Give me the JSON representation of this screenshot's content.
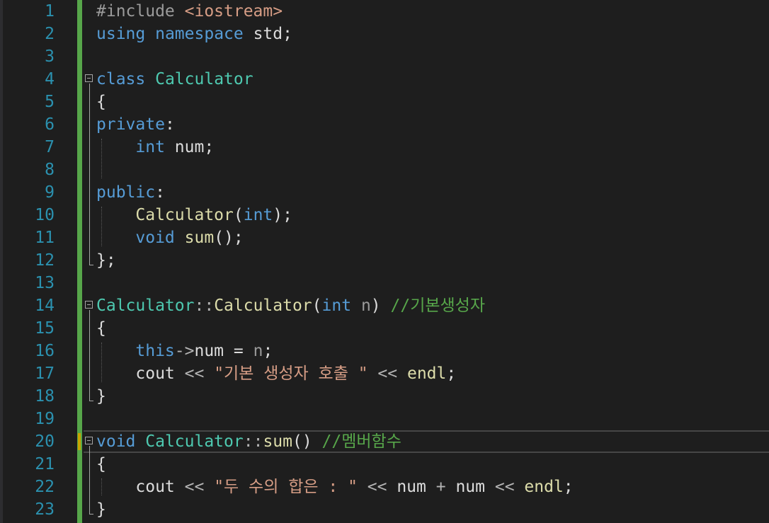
{
  "editor": {
    "lines": [
      {
        "n": "1",
        "tokens": [
          {
            "c": "pp",
            "t": "#include "
          },
          {
            "c": "inc",
            "t": "<iostream>"
          }
        ]
      },
      {
        "n": "2",
        "tokens": [
          {
            "c": "kw",
            "t": "using"
          },
          {
            "c": "txt",
            "t": " "
          },
          {
            "c": "kw",
            "t": "namespace"
          },
          {
            "c": "txt",
            "t": " std;"
          }
        ]
      },
      {
        "n": "3",
        "tokens": []
      },
      {
        "n": "4",
        "fold": true,
        "tokens": [
          {
            "c": "kw",
            "t": "class"
          },
          {
            "c": "txt",
            "t": " "
          },
          {
            "c": "type",
            "t": "Calculator"
          }
        ]
      },
      {
        "n": "5",
        "tokens": [
          {
            "c": "txt",
            "t": "{"
          }
        ]
      },
      {
        "n": "6",
        "tokens": [
          {
            "c": "kw",
            "t": "private"
          },
          {
            "c": "txt",
            "t": ":"
          }
        ]
      },
      {
        "n": "7",
        "tokens": [
          {
            "c": "txt",
            "t": "    "
          },
          {
            "c": "kw",
            "t": "int"
          },
          {
            "c": "txt",
            "t": " num;"
          }
        ]
      },
      {
        "n": "8",
        "tokens": []
      },
      {
        "n": "9",
        "tokens": [
          {
            "c": "kw",
            "t": "public"
          },
          {
            "c": "txt",
            "t": ":"
          }
        ]
      },
      {
        "n": "10",
        "tokens": [
          {
            "c": "txt",
            "t": "    "
          },
          {
            "c": "fn",
            "t": "Calculator"
          },
          {
            "c": "txt",
            "t": "("
          },
          {
            "c": "kw",
            "t": "int"
          },
          {
            "c": "txt",
            "t": ");"
          }
        ]
      },
      {
        "n": "11",
        "tokens": [
          {
            "c": "txt",
            "t": "    "
          },
          {
            "c": "kw",
            "t": "void"
          },
          {
            "c": "txt",
            "t": " "
          },
          {
            "c": "fn",
            "t": "sum"
          },
          {
            "c": "txt",
            "t": "();"
          }
        ]
      },
      {
        "n": "12",
        "tokens": [
          {
            "c": "txt",
            "t": "};"
          }
        ]
      },
      {
        "n": "13",
        "tokens": []
      },
      {
        "n": "14",
        "fold": true,
        "tokens": [
          {
            "c": "type",
            "t": "Calculator"
          },
          {
            "c": "op",
            "t": "::"
          },
          {
            "c": "fn",
            "t": "Calculator"
          },
          {
            "c": "txt",
            "t": "("
          },
          {
            "c": "kw",
            "t": "int"
          },
          {
            "c": "txt",
            "t": " "
          },
          {
            "c": "param",
            "t": "n"
          },
          {
            "c": "txt",
            "t": ") "
          },
          {
            "c": "cmt",
            "t": "//기본생성자"
          }
        ]
      },
      {
        "n": "15",
        "tokens": [
          {
            "c": "txt",
            "t": "{"
          }
        ]
      },
      {
        "n": "16",
        "tokens": [
          {
            "c": "txt",
            "t": "    "
          },
          {
            "c": "kw",
            "t": "this"
          },
          {
            "c": "op",
            "t": "->"
          },
          {
            "c": "txt",
            "t": "num = "
          },
          {
            "c": "param",
            "t": "n"
          },
          {
            "c": "txt",
            "t": ";"
          }
        ]
      },
      {
        "n": "17",
        "tokens": [
          {
            "c": "txt",
            "t": "    cout "
          },
          {
            "c": "op",
            "t": "<<"
          },
          {
            "c": "txt",
            "t": " "
          },
          {
            "c": "str",
            "t": "\"기본 생성자 호출 \""
          },
          {
            "c": "txt",
            "t": " "
          },
          {
            "c": "op",
            "t": "<<"
          },
          {
            "c": "txt",
            "t": " "
          },
          {
            "c": "fn",
            "t": "endl"
          },
          {
            "c": "txt",
            "t": ";"
          }
        ]
      },
      {
        "n": "18",
        "tokens": [
          {
            "c": "txt",
            "t": "}"
          }
        ]
      },
      {
        "n": "19",
        "tokens": []
      },
      {
        "n": "20",
        "fold": true,
        "current": true,
        "tokens": [
          {
            "c": "kw",
            "t": "void"
          },
          {
            "c": "txt",
            "t": " "
          },
          {
            "c": "type",
            "t": "Calculator"
          },
          {
            "c": "op",
            "t": "::"
          },
          {
            "c": "fn",
            "t": "sum"
          },
          {
            "c": "txt",
            "t": "() "
          },
          {
            "c": "cmt",
            "t": "//멤버함수"
          }
        ]
      },
      {
        "n": "21",
        "tokens": [
          {
            "c": "txt",
            "t": "{"
          }
        ]
      },
      {
        "n": "22",
        "tokens": [
          {
            "c": "txt",
            "t": "    cout "
          },
          {
            "c": "op",
            "t": "<<"
          },
          {
            "c": "txt",
            "t": " "
          },
          {
            "c": "str",
            "t": "\"두 수의 합은 : \""
          },
          {
            "c": "txt",
            "t": " "
          },
          {
            "c": "op",
            "t": "<<"
          },
          {
            "c": "txt",
            "t": " num "
          },
          {
            "c": "op",
            "t": "+"
          },
          {
            "c": "txt",
            "t": " num "
          },
          {
            "c": "op",
            "t": "<<"
          },
          {
            "c": "txt",
            "t": " "
          },
          {
            "c": "fn",
            "t": "endl"
          },
          {
            "c": "txt",
            "t": ";"
          }
        ]
      },
      {
        "n": "23",
        "tokens": [
          {
            "c": "txt",
            "t": "}"
          }
        ]
      }
    ]
  }
}
